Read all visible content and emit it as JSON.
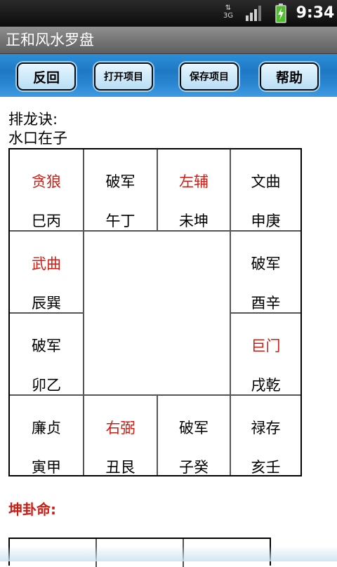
{
  "status": {
    "network": "3G",
    "time": "9:34"
  },
  "app": {
    "title": "正和风水罗盘"
  },
  "toolbar": {
    "back_label": "反回",
    "open_label": "打开项目",
    "save_label": "保存项目",
    "help_label": "帮助"
  },
  "content": {
    "heading": "排龙诀:",
    "subheading": "水口在子",
    "grid": [
      {
        "star": "贪狼",
        "dir": "巳丙",
        "highlight": true
      },
      {
        "star": "破军",
        "dir": "午丁",
        "highlight": false
      },
      {
        "star": "左辅",
        "dir": "未坤",
        "highlight": true
      },
      {
        "star": "文曲",
        "dir": "申庚",
        "highlight": false
      },
      {
        "star": "武曲",
        "dir": "辰巽",
        "highlight": true
      },
      {
        "star": "破军",
        "dir": "酉辛",
        "highlight": false
      },
      {
        "star": "破军",
        "dir": "卯乙",
        "highlight": false
      },
      {
        "star": "巨门",
        "dir": "戌乾",
        "highlight": true
      },
      {
        "star": "廉贞",
        "dir": "寅甲",
        "highlight": false
      },
      {
        "star": "右弼",
        "dir": "丑艮",
        "highlight": true
      },
      {
        "star": "破军",
        "dir": "子癸",
        "highlight": false
      },
      {
        "star": "禄存",
        "dir": "亥壬",
        "highlight": false
      }
    ],
    "section_label": "坤卦命:"
  },
  "colors": {
    "highlight": "#cc1d14",
    "toolbar_blue": "#1f78c4",
    "title_bar": "#6e6e6e"
  }
}
